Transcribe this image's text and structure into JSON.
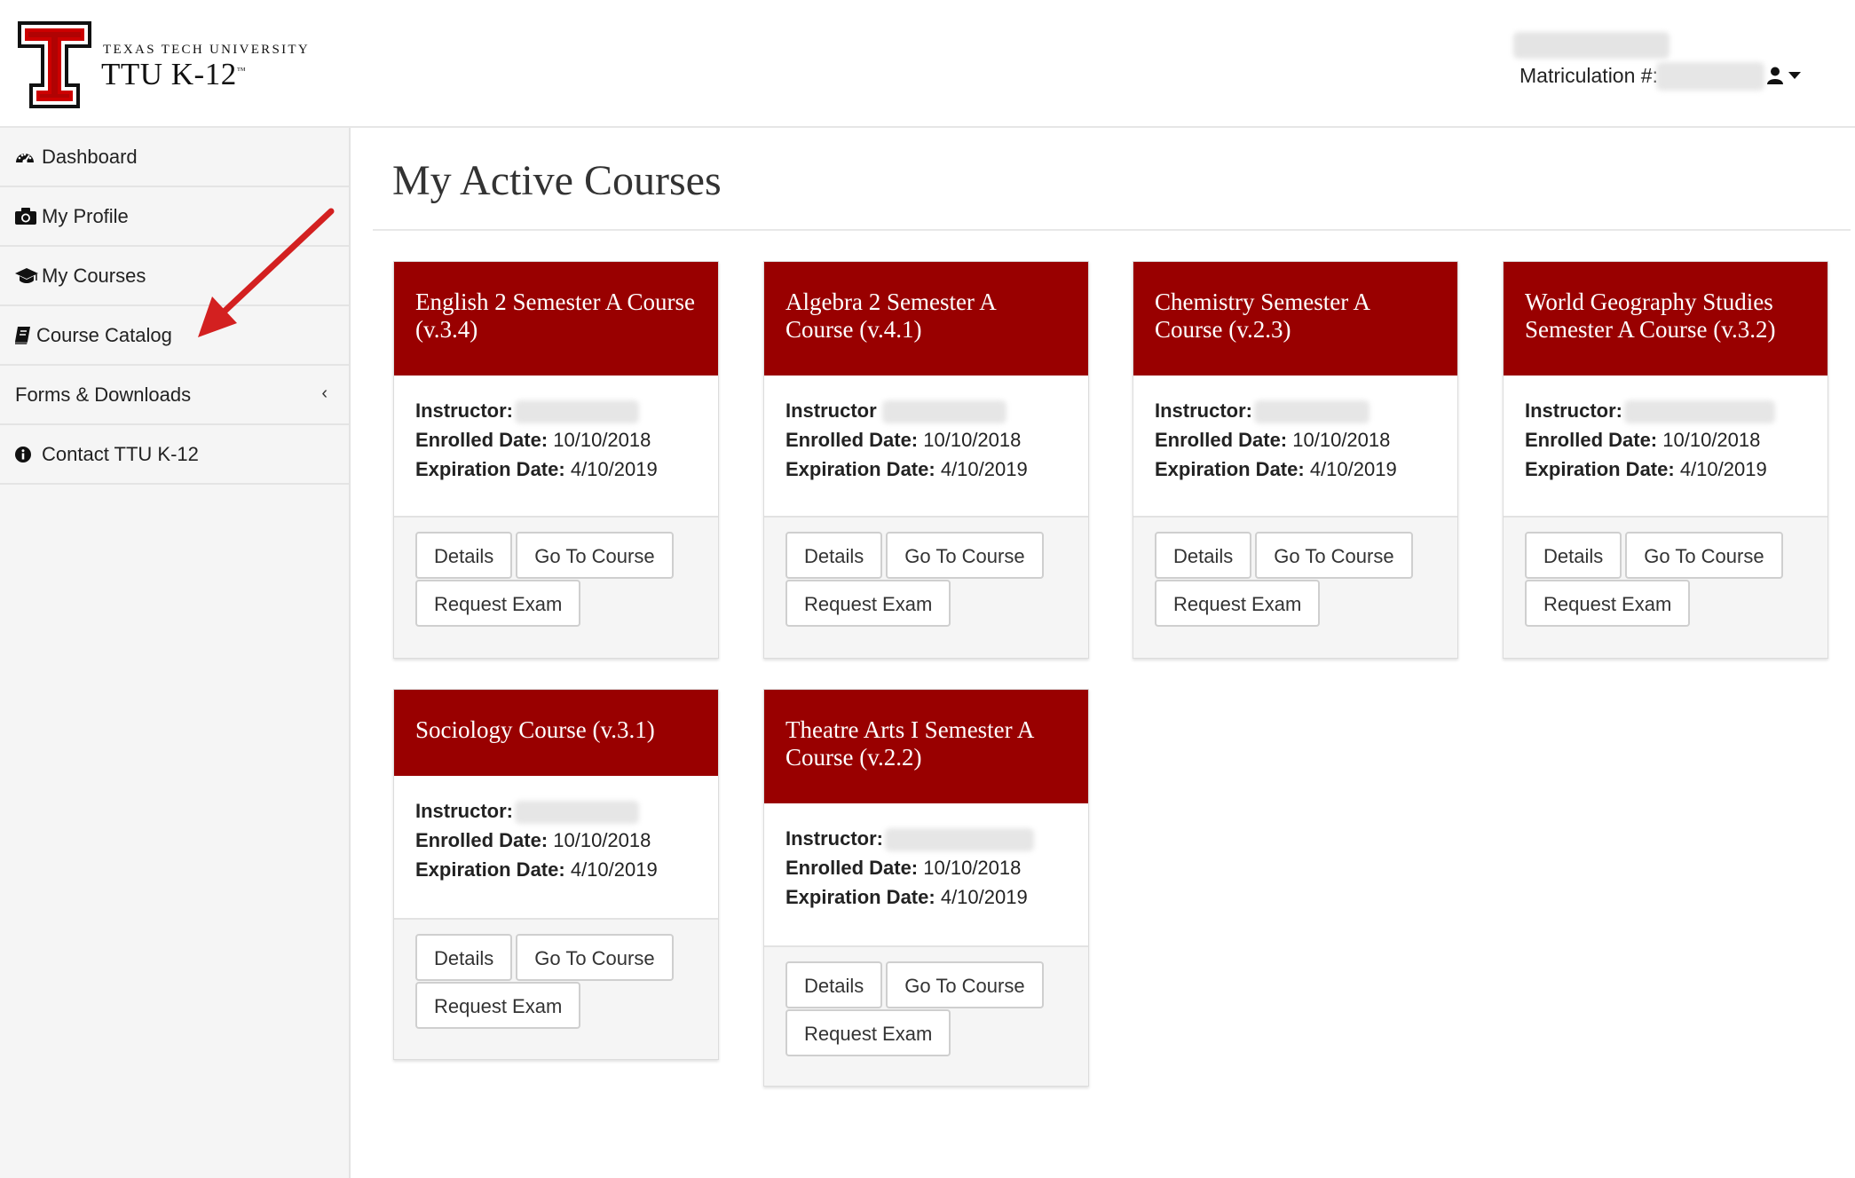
{
  "header": {
    "logo_small": "TEXAS TECH UNIVERSITY",
    "logo_big": "TTU K-12",
    "logo_tm": "™",
    "matriculation_label": "Matriculation #:"
  },
  "colors": {
    "brand": "#990000",
    "sidebar_bg": "#f5f5f5",
    "annotation_arrow": "#d32020"
  },
  "sidebar": {
    "items": [
      {
        "label": "Dashboard",
        "icon": "dashboard-icon"
      },
      {
        "label": "My Profile",
        "icon": "camera-icon"
      },
      {
        "label": "My Courses",
        "icon": "graduation-cap-icon"
      },
      {
        "label": "Course Catalog",
        "icon": "book-icon"
      },
      {
        "label": "Forms & Downloads",
        "icon": "chevron-left-icon"
      },
      {
        "label": "Contact TTU K-12",
        "icon": "info-circle-icon"
      }
    ]
  },
  "main": {
    "title": "My Active Courses",
    "labels": {
      "instructor": "Instructor:",
      "instructor_alt": "Instructor",
      "enrolled": "Enrolled Date:",
      "expiration": "Expiration Date:"
    },
    "buttons": {
      "details": "Details",
      "go": "Go To Course",
      "exam": "Request Exam"
    },
    "courses": [
      {
        "title": "English 2 Semester A Course (v.3.4)",
        "enrolled": "10/10/2018",
        "expiration": "4/10/2019"
      },
      {
        "title": "Algebra 2 Semester A Course (v.4.1)",
        "enrolled": "10/10/2018",
        "expiration": "4/10/2019"
      },
      {
        "title": "Chemistry Semester A Course (v.2.3)",
        "enrolled": "10/10/2018",
        "expiration": "4/10/2019"
      },
      {
        "title": "World Geography Studies Semester A Course (v.3.2)",
        "enrolled": "10/10/2018",
        "expiration": "4/10/2019"
      },
      {
        "title": "Sociology Course (v.3.1)",
        "enrolled": "10/10/2018",
        "expiration": "4/10/2019"
      },
      {
        "title": "Theatre Arts I Semester A Course (v.2.2)",
        "enrolled": "10/10/2018",
        "expiration": "4/10/2019"
      }
    ]
  }
}
